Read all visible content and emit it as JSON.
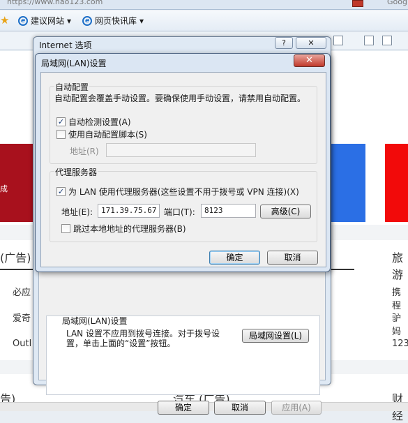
{
  "browser": {
    "address_text": "https://www.hao123.com",
    "right_text": "Goog",
    "favorites": [
      {
        "label": "建议网站"
      },
      {
        "label": "网页快讯库"
      }
    ]
  },
  "page": {
    "left_banner_text": "成",
    "ad_title_left": "(广告)",
    "list_left": [
      "必应",
      "爱奇",
      "Outl"
    ],
    "bottom_left": "告)",
    "bottom_center": "汽车 (广告)",
    "right_title": "旅游",
    "list_right": [
      "携程",
      "驴妈",
      "123"
    ],
    "bottom_right": "财经"
  },
  "outer_dialog": {
    "title": "Internet 选项",
    "help_label": "?",
    "close_label": "✕",
    "lan_group_title": "局域网(LAN)设置",
    "lan_desc": "LAN 设置不应用到拨号连接。对于拨号设置，单击上面的“设置”按钮。",
    "lan_button": "局域网设置(L)",
    "ok": "确定",
    "cancel": "取消",
    "apply": "应用(A)"
  },
  "lan_dialog": {
    "title": "局域网(LAN)设置",
    "close_label": "✕",
    "auto_config": {
      "title": "自动配置",
      "desc": "自动配置会覆盖手动设置。要确保使用手动设置，请禁用自动配置。",
      "auto_detect": {
        "label": "自动检测设置(A)",
        "checked": true
      },
      "use_script": {
        "label": "使用自动配置脚本(S)",
        "checked": false
      },
      "address_label": "地址(R)",
      "address_value": ""
    },
    "proxy": {
      "title": "代理服务器",
      "use_proxy": {
        "label": "为 LAN 使用代理服务器(这些设置不用于拨号或 VPN 连接)(X)",
        "checked": true
      },
      "address_label": "地址(E):",
      "address_value": "171.39.75.67",
      "port_label": "端口(T):",
      "port_value": "8123",
      "advanced": "高级(C)",
      "bypass_local": {
        "label": "跳过本地地址的代理服务器(B)",
        "checked": false
      }
    },
    "ok": "确定",
    "cancel": "取消"
  },
  "colors": {
    "red_block": "#a8111d",
    "blue_block": "#2b6fe5",
    "bright_red": "#f20a0a"
  }
}
